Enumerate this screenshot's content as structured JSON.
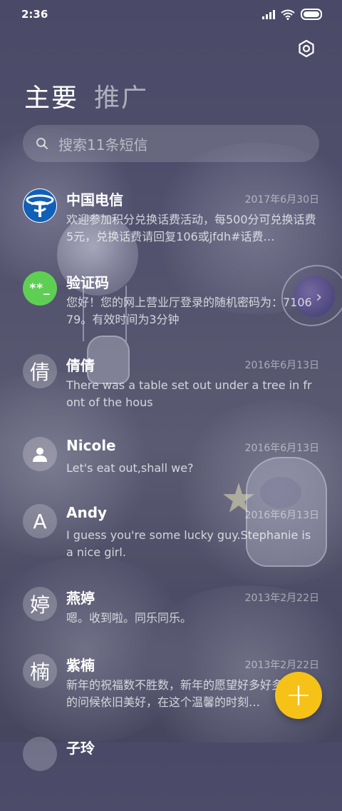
{
  "status_bar": {
    "time": "2:36"
  },
  "header": {
    "tabs": [
      {
        "label": "主要"
      },
      {
        "label": "推广"
      }
    ],
    "settings_icon": "gear-icon"
  },
  "search": {
    "placeholder": "搜索11条短信"
  },
  "conversations": [
    {
      "name": "中国电信",
      "date": "2017年6月30日",
      "avatar": "china-telecom-logo",
      "preview": "欢迎参加积分兑换话费活动，每500分可兑换话费5元，兑换话费请回复106或jfdh#话费…"
    },
    {
      "name": "验证码",
      "date": "",
      "avatar_text": "**_",
      "avatar": "verification-code-avatar",
      "preview": "您好！您的网上营业厅登录的随机密码为：710679。有效时间为3分钟"
    },
    {
      "name": "倩倩",
      "date": "2016年6月13日",
      "avatar_text": "倩",
      "preview": "There was a table set out under a tree in front of the hous"
    },
    {
      "name": "Nicole",
      "date": "2016年6月13日",
      "avatar": "person-icon",
      "preview": "Let's eat out,shall we?"
    },
    {
      "name": "Andy",
      "date": "2016年6月13日",
      "avatar_text": "A",
      "preview": "I guess you're some lucky guy.Stephanie is a nice girl."
    },
    {
      "name": "燕婷",
      "date": "2013年2月22日",
      "avatar_text": "婷",
      "preview": "嗯。收到啦。同乐同乐。"
    },
    {
      "name": "紫楠",
      "date": "2013年2月22日",
      "avatar_text": "楠",
      "preview": "新年的祝福数不胜数，新年的愿望好多好多，新年的问候依旧美好，在这个温馨的时刻…"
    },
    {
      "name": "子玲",
      "date": "",
      "avatar_text": "",
      "preview": ""
    }
  ],
  "colors": {
    "fab": "#f6c218",
    "code_avatar": "#5fcf54",
    "telecom_blue": "#1060b8"
  },
  "fab": {
    "label": "+"
  }
}
